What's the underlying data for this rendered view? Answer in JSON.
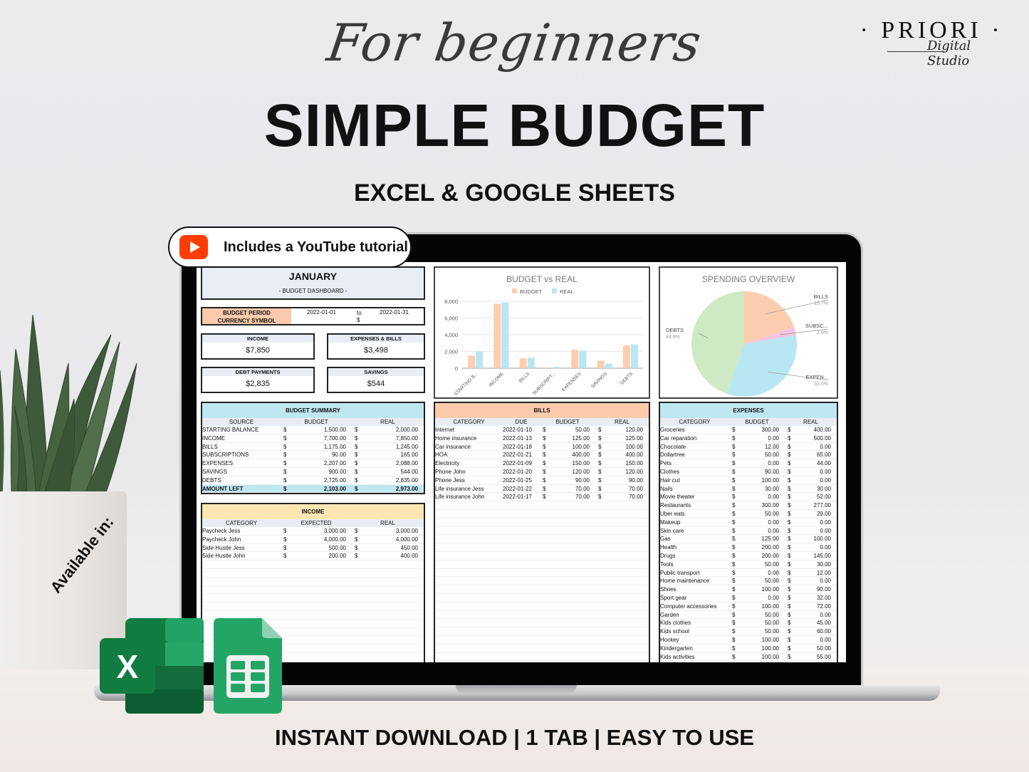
{
  "header": {
    "script_title": "For beginners",
    "main_title": "SIMPLE BUDGET",
    "sub_title": "EXCEL & GOOGLE SHEETS",
    "brand_name": "· PRIORI ·",
    "brand_sub": "Digital Studio"
  },
  "badge": {
    "icon": "youtube-play-icon",
    "text": "Includes a YouTube tutorial"
  },
  "available": {
    "label": "Available in:",
    "apps": [
      "excel-icon",
      "google-sheets-icon"
    ]
  },
  "footer": {
    "text": "INSTANT DOWNLOAD  |  1 TAB | EASY TO USE"
  },
  "dashboard": {
    "month": "JANUARY",
    "subtitle": "- BUDGET DASHBOARD -",
    "period_label": "BUDGET PERIOD",
    "currency_label": "CURRENCY SYMBOL",
    "period_start": "2022-01-01",
    "period_to": "to",
    "period_end": "2022-01-31",
    "currency": "$",
    "kpis": [
      {
        "label": "INCOME",
        "value": "$7,850"
      },
      {
        "label": "EXPENSES & BILLS",
        "value": "$3,498"
      },
      {
        "label": "DEBT PAYMENTS",
        "value": "$2,835"
      },
      {
        "label": "SAVINGS",
        "value": "$544"
      }
    ]
  },
  "budget_summary": {
    "title": "BUDGET SUMMARY",
    "columns": [
      "SOURCE",
      "BUDGET",
      "REAL"
    ],
    "rows": [
      [
        "STARTING BALANCE",
        "$",
        "1,500.00",
        "$",
        "2,000.00"
      ],
      [
        "INCOME",
        "$",
        "7,700.00",
        "$",
        "7,850.00"
      ],
      [
        "BILLS",
        "$",
        "1,175.00",
        "$",
        "1,245.00"
      ],
      [
        "SUBSCRIPTIONS",
        "$",
        "90.00",
        "$",
        "165.00"
      ],
      [
        "EXPENSES",
        "$",
        "2,207.00",
        "$",
        "2,088.00"
      ],
      [
        "SAVINGS",
        "$",
        "900.00",
        "$",
        "544.00"
      ],
      [
        "DEBTS",
        "$",
        "2,725.00",
        "$",
        "2,835.00"
      ]
    ],
    "total": [
      "AMOUNT LEFT",
      "$",
      "2,103.00",
      "$",
      "2,973.00"
    ]
  },
  "income": {
    "title": "INCOME",
    "columns": [
      "CATEGORY",
      "EXPECTED",
      "REAL"
    ],
    "rows": [
      [
        "Paycheck Jess",
        "$",
        "3,000.00",
        "$",
        "3,000.00"
      ],
      [
        "Paycheck John",
        "$",
        "4,000.00",
        "$",
        "4,000.00"
      ],
      [
        "Side Hustle Jess",
        "$",
        "500.00",
        "$",
        "450.00"
      ],
      [
        "Side Hustle John",
        "$",
        "200.00",
        "$",
        "400.00"
      ]
    ]
  },
  "bills": {
    "title": "BILLS",
    "columns": [
      "CATEGORY",
      "DUE",
      "BUDGET",
      "REAL"
    ],
    "rows": [
      [
        "Internet",
        "2022-01-10",
        "$",
        "50.00",
        "$",
        "120.00"
      ],
      [
        "Home insurance",
        "2022-01-13",
        "$",
        "125.00",
        "$",
        "125.00"
      ],
      [
        "Car insurance",
        "2022-01-18",
        "$",
        "100.00",
        "$",
        "100.00"
      ],
      [
        "HOA",
        "2022-01-21",
        "$",
        "400.00",
        "$",
        "400.00"
      ],
      [
        "Electricity",
        "2022-01-09",
        "$",
        "150.00",
        "$",
        "150.00"
      ],
      [
        "Phone John",
        "2022-01-20",
        "$",
        "120.00",
        "$",
        "120.00"
      ],
      [
        "Phone Jess",
        "2022-01-25",
        "$",
        "90.00",
        "$",
        "90.00"
      ],
      [
        "Life insurance Jess",
        "2022-01-22",
        "$",
        "70.00",
        "$",
        "70.00"
      ],
      [
        "Life insurance John",
        "2022-01-17",
        "$",
        "70.00",
        "$",
        "70.00"
      ]
    ]
  },
  "expenses": {
    "title": "EXPENSES",
    "columns": [
      "CATEGORY",
      "BUDGET",
      "REAL"
    ],
    "rows": [
      [
        "Groceries",
        "$",
        "300.00",
        "$",
        "400.00"
      ],
      [
        "Car reparation",
        "$",
        "0.00",
        "$",
        "500.00"
      ],
      [
        "Chocolate",
        "$",
        "12.00",
        "$",
        "0.00"
      ],
      [
        "Dollartree",
        "$",
        "50.00",
        "$",
        "65.00"
      ],
      [
        "Pets",
        "$",
        "0.00",
        "$",
        "44.00"
      ],
      [
        "Clothes",
        "$",
        "90.00",
        "$",
        "0.00"
      ],
      [
        "Hair cut",
        "$",
        "100.00",
        "$",
        "0.00"
      ],
      [
        "Nails",
        "$",
        "30.00",
        "$",
        "30.00"
      ],
      [
        "Movie theater",
        "$",
        "0.00",
        "$",
        "52.00"
      ],
      [
        "Restaurants",
        "$",
        "300.00",
        "$",
        "277.00"
      ],
      [
        "Uber eats",
        "$",
        "50.00",
        "$",
        "29.00"
      ],
      [
        "Makeup",
        "$",
        "0.00",
        "$",
        "0.00"
      ],
      [
        "Skin care",
        "$",
        "0.00",
        "$",
        "0.00"
      ],
      [
        "Gas",
        "$",
        "125.00",
        "$",
        "100.00"
      ],
      [
        "Health",
        "$",
        "200.00",
        "$",
        "0.00"
      ],
      [
        "Drugs",
        "$",
        "200.00",
        "$",
        "145.00"
      ],
      [
        "Tools",
        "$",
        "50.00",
        "$",
        "30.00"
      ],
      [
        "Public transport",
        "$",
        "0.00",
        "$",
        "12.00"
      ],
      [
        "Home maintenance",
        "$",
        "50.00",
        "$",
        "0.00"
      ],
      [
        "Shoes",
        "$",
        "100.00",
        "$",
        "90.00"
      ],
      [
        "Sport gear",
        "$",
        "0.00",
        "$",
        "32.00"
      ],
      [
        "Computer accessories",
        "$",
        "100.00",
        "$",
        "72.00"
      ],
      [
        "Garden",
        "$",
        "50.00",
        "$",
        "0.00"
      ],
      [
        "Kids clothes",
        "$",
        "50.00",
        "$",
        "45.00"
      ],
      [
        "Kids school",
        "$",
        "50.00",
        "$",
        "60.00"
      ],
      [
        "Hockey",
        "$",
        "100.00",
        "$",
        "0.00"
      ],
      [
        "Kindergarten",
        "$",
        "100.00",
        "$",
        "50.00"
      ],
      [
        "Kids activities",
        "$",
        "100.00",
        "$",
        "55.00"
      ]
    ]
  },
  "colors": {
    "budget": "#fdcdb0",
    "real": "#b8e6f3",
    "bills": "#fdcdb0",
    "subscriptions": "#f7c4de",
    "expenses": "#b8e6f3",
    "debts": "#cdeac4",
    "income_header": "#fde6b3",
    "summary_header": "#bfe7f2",
    "bills_header": "#fccbac",
    "expenses_header": "#bfe7f2"
  },
  "chart_data": [
    {
      "type": "bar",
      "title": "BUDGET vs REAL",
      "categories": [
        "STARTING B...",
        "INCOME",
        "BILLS",
        "SUBSCRIPT...",
        "EXPENSES",
        "SAVINGS",
        "DEBTS"
      ],
      "series": [
        {
          "name": "BUDGET",
          "values": [
            1500,
            7700,
            1175,
            90,
            2207,
            900,
            2725
          ]
        },
        {
          "name": "REAL",
          "values": [
            2000,
            7850,
            1245,
            165,
            2088,
            544,
            2835
          ]
        }
      ],
      "yticks": [
        "0",
        "2,000",
        "4,000",
        "6,000",
        "8,000"
      ],
      "ylim": [
        0,
        8000
      ],
      "legend": "top",
      "grid": true,
      "xlabel": "",
      "ylabel": ""
    },
    {
      "type": "pie",
      "title": "SPENDING OVERVIEW",
      "slices": [
        {
          "label": "BILLS",
          "pct": 19.7,
          "pct_label": "19.7%"
        },
        {
          "label": "SUBSC...",
          "pct": 2.6,
          "pct_label": "2.6%"
        },
        {
          "label": "EXPEN...",
          "pct": 33.0,
          "pct_label": "33.0%"
        },
        {
          "label": "DEBTS",
          "pct": 44.8,
          "pct_label": "44.8%"
        }
      ]
    }
  ]
}
